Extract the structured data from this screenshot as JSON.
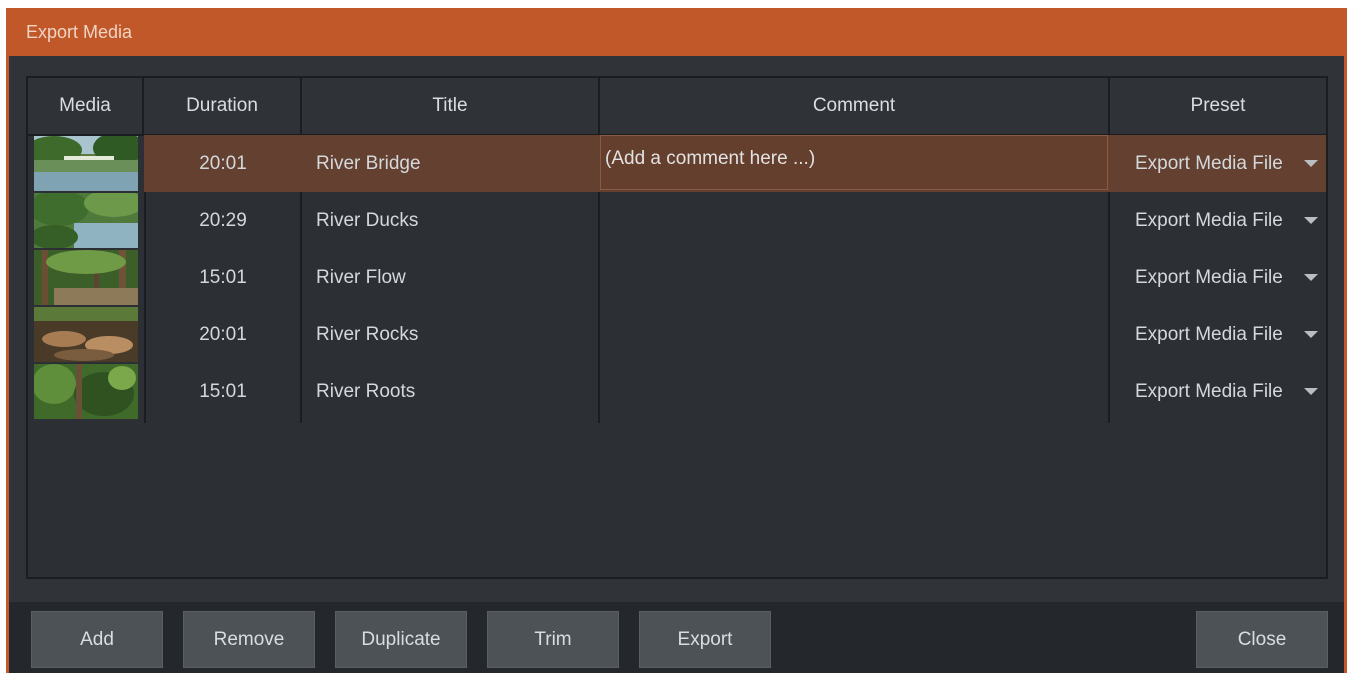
{
  "window": {
    "title": "Export Media"
  },
  "table": {
    "columns": [
      "Media",
      "Duration",
      "Title",
      "Comment",
      "Preset"
    ],
    "rows": [
      {
        "duration": "20:01",
        "title": "River Bridge",
        "comment": "(Add a comment here ...)",
        "preset": "Export Media File",
        "selected": true
      },
      {
        "duration": "20:29",
        "title": "River Ducks",
        "comment": "",
        "preset": "Export Media File",
        "selected": false
      },
      {
        "duration": "15:01",
        "title": "River Flow",
        "comment": "",
        "preset": "Export Media File",
        "selected": false
      },
      {
        "duration": "20:01",
        "title": "River Rocks",
        "comment": "",
        "preset": "Export Media File",
        "selected": false
      },
      {
        "duration": "15:01",
        "title": "River Roots",
        "comment": "",
        "preset": "Export Media File",
        "selected": false
      }
    ]
  },
  "buttons": {
    "add": "Add",
    "remove": "Remove",
    "duplicate": "Duplicate",
    "trim": "Trim",
    "export": "Export",
    "close": "Close"
  },
  "colors": {
    "accent": "#c1582a",
    "selected_row": "#63402f",
    "panel": "#303438"
  }
}
